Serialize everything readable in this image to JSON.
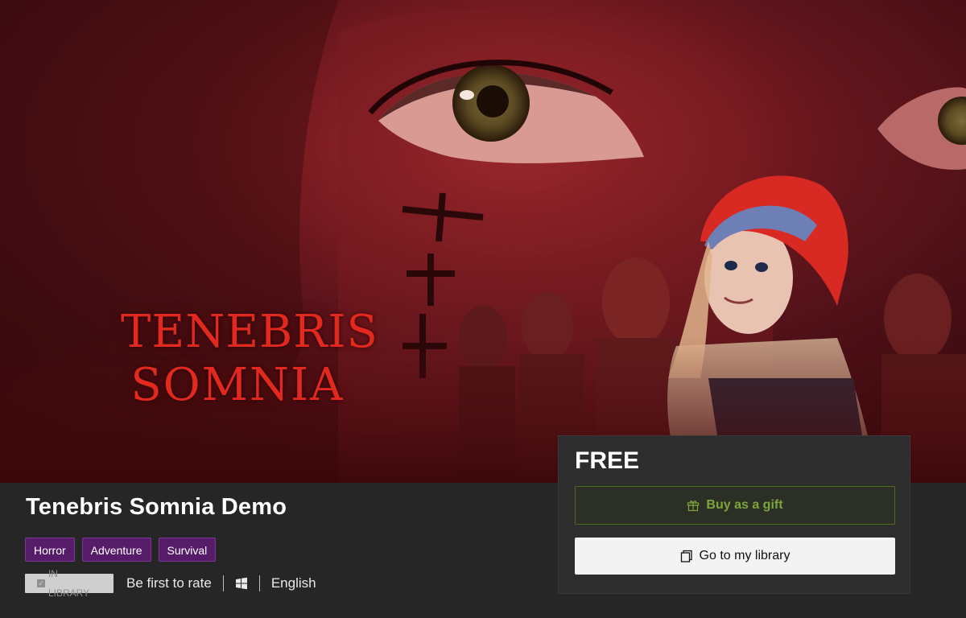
{
  "hero": {
    "logo_line1": "TENEBRIS",
    "logo_line2": "SOMNIA"
  },
  "game": {
    "title": "Tenebris Somnia Demo",
    "tags": [
      "Horror",
      "Adventure",
      "Survival"
    ],
    "library_badge": "IN LIBRARY",
    "rating_text": "Be first to rate",
    "platform_icon": "windows-icon",
    "language": "English"
  },
  "purchase": {
    "price": "FREE",
    "gift_label": "Buy as a gift",
    "gift_icon": "gift-icon",
    "library_label": "Go to my library",
    "library_icon": "copy-icon"
  },
  "colors": {
    "page_bg": "#262626",
    "tag_bg": "#561c69",
    "gift_accent": "#7da63b",
    "logo_red": "#e3281e"
  }
}
